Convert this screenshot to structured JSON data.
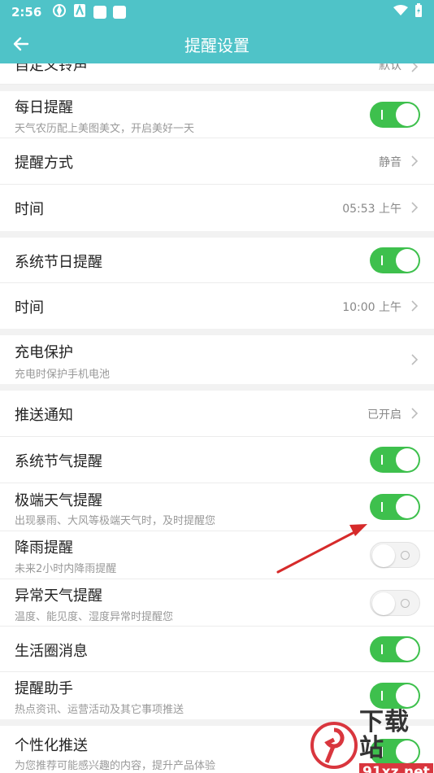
{
  "status_bar": {
    "time": "2:56",
    "icons": [
      "pinwheel-icon",
      "app-a-icon",
      "square-icon",
      "square-icon"
    ],
    "right_icons": [
      "wifi-icon",
      "battery-icon"
    ]
  },
  "app_bar": {
    "title": "提醒设置",
    "back_icon": "arrow-left-icon"
  },
  "rows": {
    "custom_ringtone": {
      "label": "自定义铃声",
      "value": "默认"
    },
    "daily_reminder": {
      "label": "每日提醒",
      "sub": "天气农历配上美图美文，开启美好一天",
      "toggle": "on"
    },
    "reminder_mode": {
      "label": "提醒方式",
      "value": "静音"
    },
    "daily_time": {
      "label": "时间",
      "value": "05:53 上午"
    },
    "holiday_reminder": {
      "label": "系统节日提醒",
      "toggle": "on"
    },
    "holiday_time": {
      "label": "时间",
      "value": "10:00 上午"
    },
    "charge_protect": {
      "label": "充电保护",
      "sub": "充电时保护手机电池"
    },
    "push_notify": {
      "label": "推送通知",
      "value": "已开启"
    },
    "solar_term": {
      "label": "系统节气提醒",
      "toggle": "on"
    },
    "extreme_weather": {
      "label": "极端天气提醒",
      "sub": "出现暴雨、大风等极端天气时，及时提醒您",
      "toggle": "on"
    },
    "rain_reminder": {
      "label": "降雨提醒",
      "sub": "未来2小时内降雨提醒",
      "toggle": "off"
    },
    "abnormal_weather": {
      "label": "异常天气提醒",
      "sub": "温度、能见度、湿度异常时提醒您",
      "toggle": "off"
    },
    "life_circle": {
      "label": "生活圈消息",
      "toggle": "on"
    },
    "assistant": {
      "label": "提醒助手",
      "sub": "热点资讯、运营活动及其它事项推送",
      "toggle": "on"
    },
    "personalized": {
      "label": "个性化推送",
      "sub": "为您推荐可能感兴趣的内容，提升产品体验",
      "toggle": "on"
    }
  },
  "watermark": {
    "cn": "下载站",
    "url": "91xz.net"
  },
  "colors": {
    "header": "#4fc3c8",
    "toggle_on": "#3ec04d",
    "arrow": "#d62a2a",
    "watermark_red": "#d9363e"
  }
}
